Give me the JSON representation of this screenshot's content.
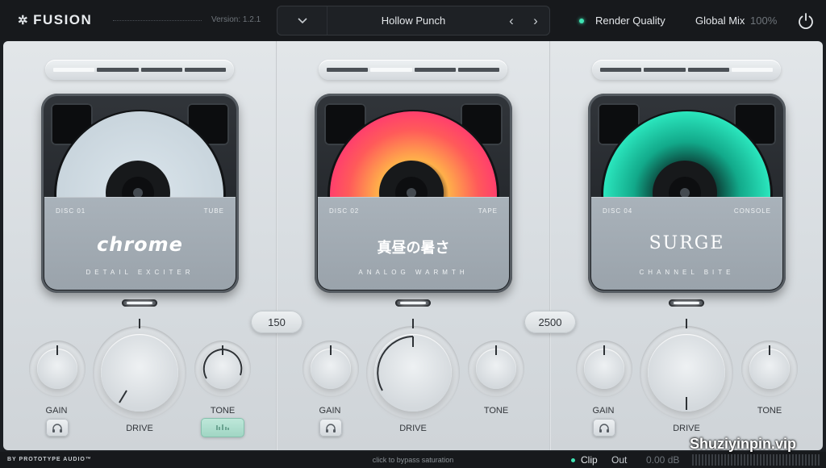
{
  "header": {
    "logo": "FUSION",
    "version": "Version: 1.2.1",
    "preset_name": "Hollow Punch",
    "render_quality": "Render Quality",
    "global_mix_label": "Global Mix",
    "global_mix_value": "100%"
  },
  "units": [
    {
      "disc_label": "DISC 01",
      "type": "TUBE",
      "name": "chrome",
      "subtitle": "DETAIL EXCITER",
      "segment_active": 0,
      "drive_level": 0.1
    },
    {
      "disc_label": "DISC 02",
      "type": "TAPE",
      "name": "真昼の暑さ",
      "subtitle": "ANALOG WARMTH",
      "segment_active": 1,
      "drive_level": 0.5
    },
    {
      "disc_label": "DISC 04",
      "type": "CONSOLE",
      "name": "SURGE",
      "subtitle": "CHANNEL BITE",
      "segment_active": 3,
      "drive_level": 1.0
    }
  ],
  "knobs": {
    "gain": "GAIN",
    "drive": "DRIVE",
    "tone": "TONE"
  },
  "crossovers": [
    "150",
    "2500"
  ],
  "footer": {
    "brand": "BY PROTOTYPE AUDIO™",
    "bypass_hint": "click to bypass saturation",
    "clip": "Clip",
    "out": "Out",
    "out_value": "0.00 dB"
  },
  "watermark": "Shuziyinpin.vip",
  "colors": {
    "accent": "#3fe3b3",
    "disc1": "#cfdbe3",
    "disc2": "#ff3f6e",
    "disc3": "#2ee8bf"
  },
  "icons": {
    "power": "power-icon",
    "headphones": "headphones-icon",
    "chevron": "chevron-down-icon"
  }
}
